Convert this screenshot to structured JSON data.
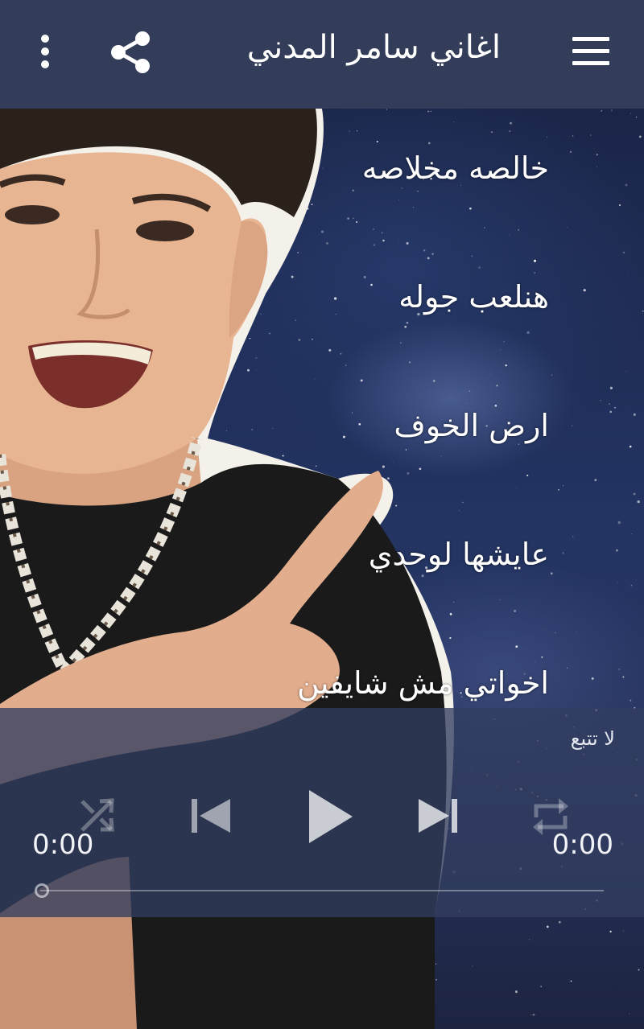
{
  "app_bar": {
    "title": "اغاني سامر المدني",
    "menu_icon": "hamburger-menu-icon",
    "share_icon": "share-icon",
    "more_icon": "more-vertical-icon",
    "background": "#333c58"
  },
  "songs": [
    {
      "title": "خالصه مخلاصه"
    },
    {
      "title": "هنلعب جوله"
    },
    {
      "title": "ارض الخوف"
    },
    {
      "title": "عايشها لوحدي"
    },
    {
      "title": "اخواتي مش شايفين"
    }
  ],
  "player": {
    "now_playing": "لا تتبع",
    "elapsed": "0:00",
    "duration": "0:00",
    "progress": 0,
    "shuffle_icon": "shuffle-icon",
    "previous_icon": "skip-previous-icon",
    "play_icon": "play-icon",
    "next_icon": "skip-next-icon",
    "repeat_icon": "repeat-icon"
  }
}
